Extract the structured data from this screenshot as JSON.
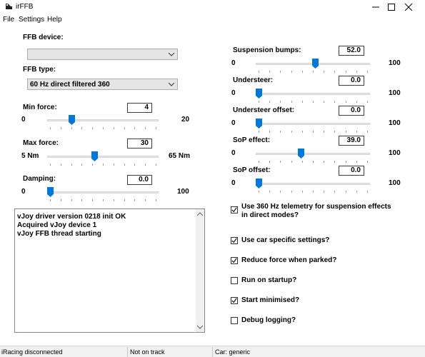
{
  "window": {
    "title": "irFFB"
  },
  "menu": {
    "file": "File",
    "settings": "Settings",
    "help": "Help"
  },
  "left": {
    "ffb_device_label": "FFB device:",
    "ffb_device_value": "",
    "ffb_type_label": "FFB type:",
    "ffb_type_value": "60 Hz direct filtered 360",
    "min_force": {
      "label": "Min force:",
      "value": "4",
      "min": "0",
      "max": "20",
      "level": 0.2
    },
    "max_force": {
      "label": "Max force:",
      "value": "30",
      "min": "5 Nm",
      "max": "65 Nm",
      "level": 0.42
    },
    "damping": {
      "label": "Damping:",
      "value": "0.0",
      "min": "0",
      "max": "100",
      "level": 0.0
    }
  },
  "right": {
    "suspension_bumps": {
      "label": "Suspension bumps:",
      "value": "52.0",
      "min": "0",
      "max": "100",
      "level": 0.52
    },
    "understeer": {
      "label": "Understeer:",
      "value": "0.0",
      "min": "0",
      "max": "100",
      "level": 0.0
    },
    "understeer_offset": {
      "label": "Understeer offset:",
      "value": "0.0",
      "min": "0",
      "max": "100",
      "level": 0.0
    },
    "sop_effect": {
      "label": "SoP effect:",
      "value": "39.0",
      "min": "0",
      "max": "100",
      "level": 0.39
    },
    "sop_offset": {
      "label": "SoP offset:",
      "value": "0.0",
      "min": "0",
      "max": "100",
      "level": 0.0
    }
  },
  "log": [
    "vJoy driver version 0218 init OK",
    "Acquired vJoy device 1",
    "vJoy FFB thread starting"
  ],
  "options": {
    "use_360_line1": "Use 360 Hz telemetry for suspension effects",
    "use_360_line2": "in direct modes?",
    "use_360_checked": true,
    "car_specific": "Use car specific settings?",
    "car_specific_checked": true,
    "reduce_force": "Reduce force when parked?",
    "reduce_force_checked": true,
    "run_on_startup": "Run on startup?",
    "run_on_startup_checked": false,
    "start_minimised": "Start minimised?",
    "start_minimised_checked": true,
    "debug_logging": "Debug logging?",
    "debug_logging_checked": false
  },
  "status": {
    "iracing": "iRacing disconnected",
    "track": "Not on track",
    "car": "Car: generic"
  }
}
